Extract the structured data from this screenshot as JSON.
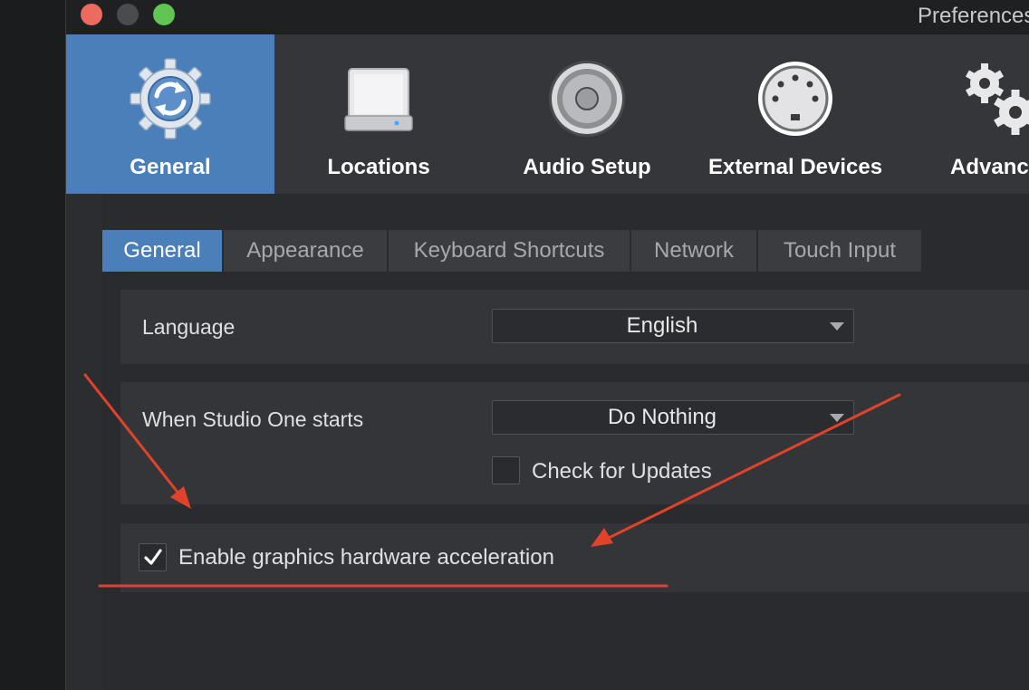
{
  "window": {
    "title": "Preferences"
  },
  "toolbar": {
    "items": [
      {
        "label": "General",
        "icon": "gear-sync-icon",
        "active": true
      },
      {
        "label": "Locations",
        "icon": "hard-drive-icon",
        "active": false
      },
      {
        "label": "Audio Setup",
        "icon": "speaker-icon",
        "active": false
      },
      {
        "label": "External Devices",
        "icon": "midi-port-icon",
        "active": false
      },
      {
        "label": "Advanced",
        "icon": "gears-icon",
        "active": false
      }
    ]
  },
  "tabs": [
    {
      "label": "General",
      "active": true
    },
    {
      "label": "Appearance",
      "active": false
    },
    {
      "label": "Keyboard Shortcuts",
      "active": false
    },
    {
      "label": "Network",
      "active": false
    },
    {
      "label": "Touch Input",
      "active": false
    }
  ],
  "settings": {
    "language": {
      "label": "Language",
      "value": "English"
    },
    "startup": {
      "label": "When Studio One starts",
      "value": "Do Nothing"
    },
    "check_updates": {
      "label": "Check for Updates",
      "checked": false
    },
    "graphics_accel": {
      "label": "Enable graphics hardware acceleration",
      "checked": true
    }
  },
  "colors": {
    "accent": "#4a7fba",
    "annotation": "#e0432a"
  }
}
